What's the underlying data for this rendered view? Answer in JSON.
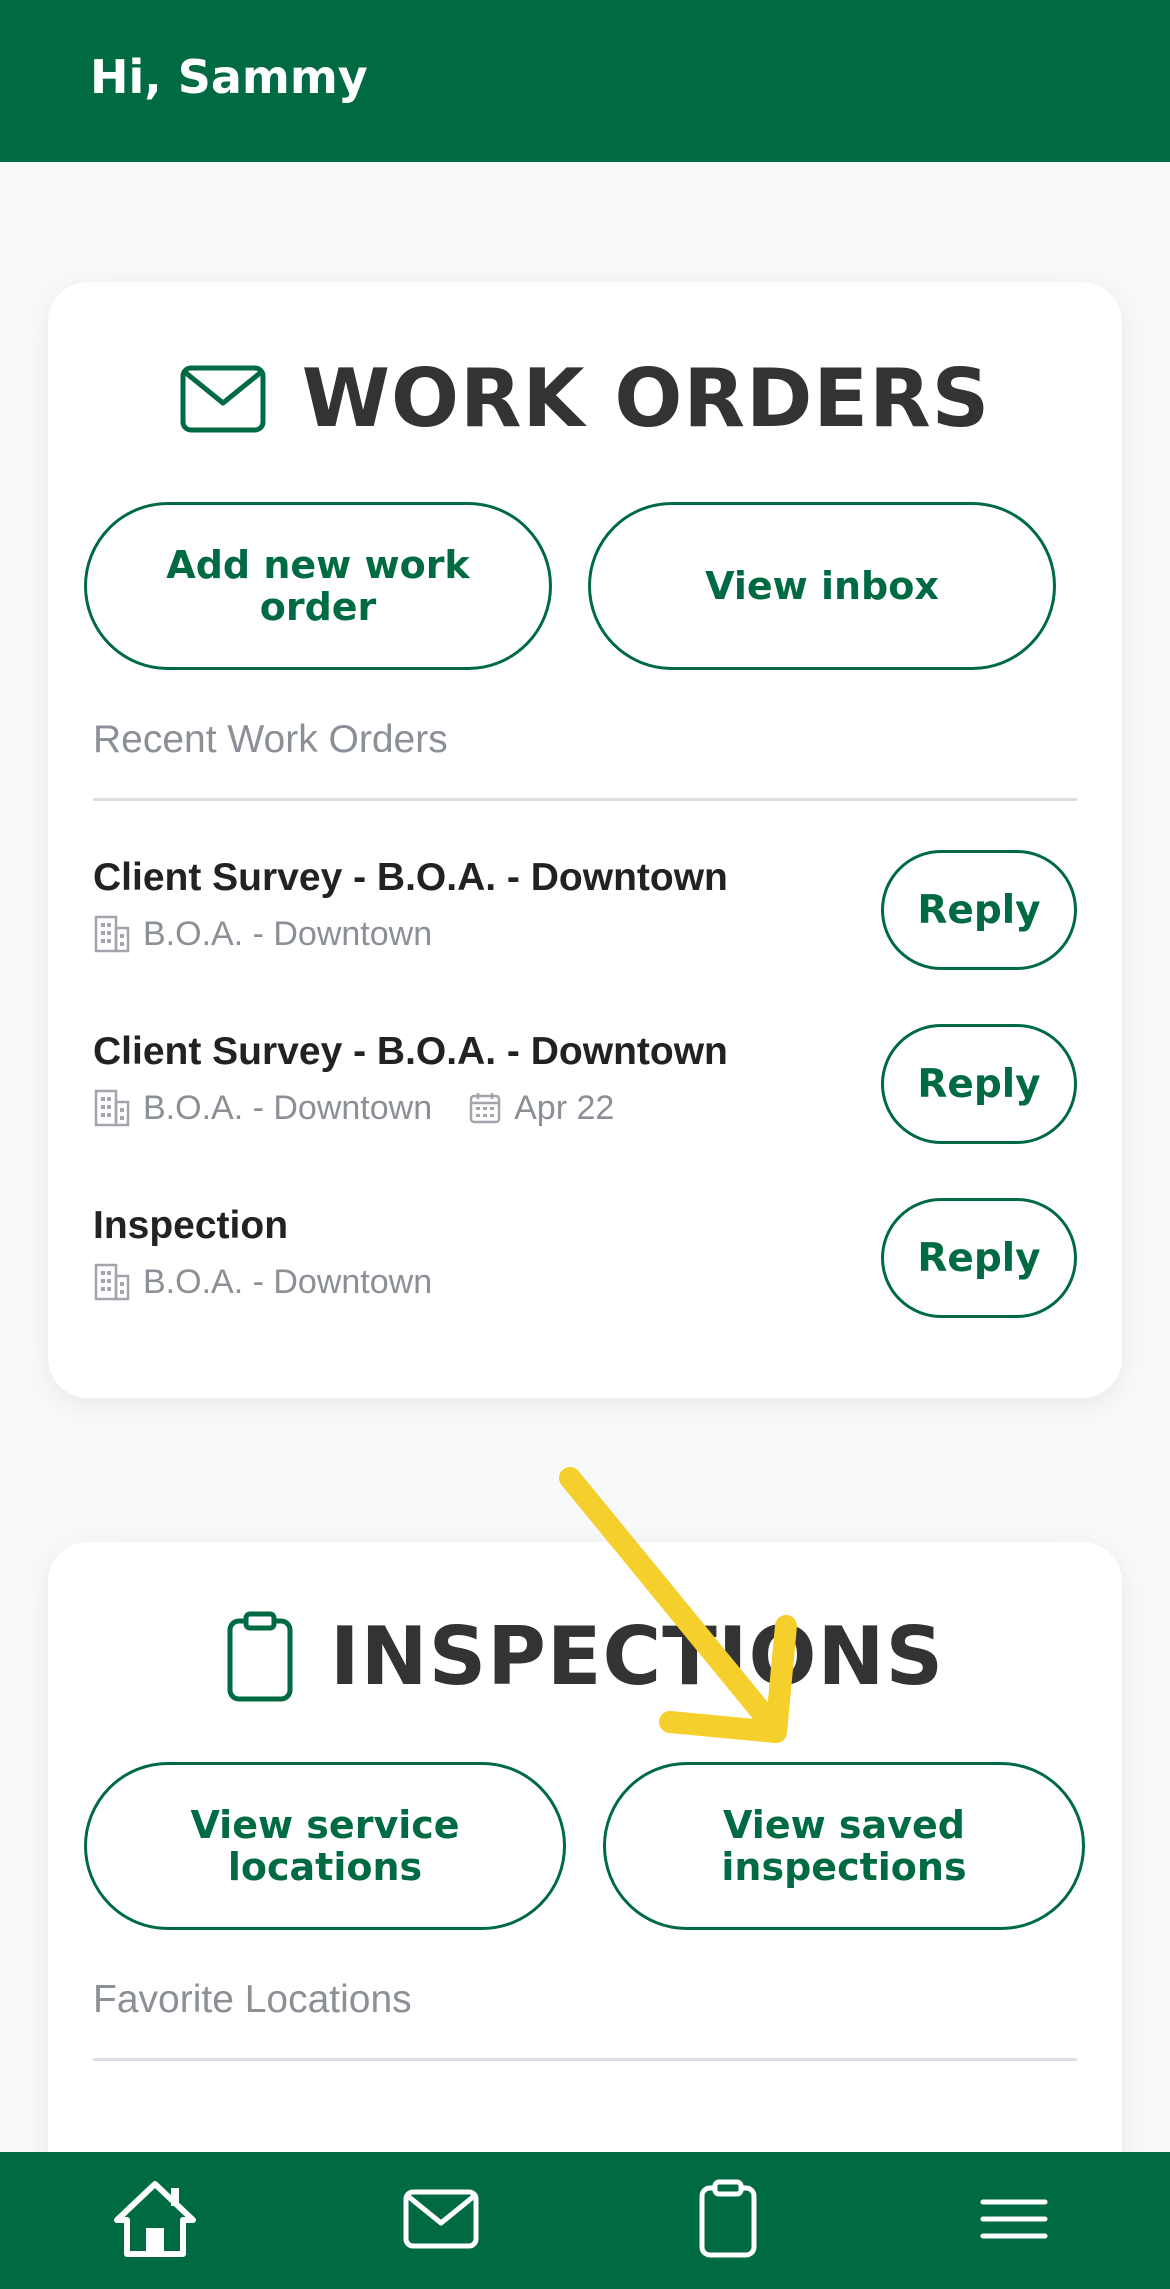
{
  "header": {
    "greeting": "Hi, Sammy"
  },
  "work_orders": {
    "title": "WORK ORDERS",
    "icon": "envelope-icon",
    "add_button": "Add new work order",
    "inbox_button": "View inbox",
    "recent_label": "Recent Work Orders",
    "items": [
      {
        "title": "Client Survey - B.O.A. - Downtown",
        "location": "B.O.A. - Downtown",
        "date": "",
        "action": "Reply"
      },
      {
        "title": "Client Survey - B.O.A. - Downtown",
        "location": "B.O.A. - Downtown",
        "date": "Apr 22",
        "action": "Reply"
      },
      {
        "title": "Inspection",
        "location": "B.O.A. - Downtown",
        "date": "",
        "action": "Reply"
      }
    ]
  },
  "inspections": {
    "title": "INSPECTIONS",
    "icon": "clipboard-icon",
    "service_button": "View service locations",
    "saved_button": "View saved inspections",
    "favorites_label": "Favorite Locations"
  },
  "bottom_nav": {
    "items": [
      {
        "icon": "home-icon"
      },
      {
        "icon": "envelope-icon"
      },
      {
        "icon": "clipboard-icon"
      },
      {
        "icon": "menu-icon"
      }
    ]
  },
  "colors": {
    "brand_green": "#006a42",
    "annotation_arrow": "#f5cf2b",
    "muted_text": "#8b8f96"
  }
}
